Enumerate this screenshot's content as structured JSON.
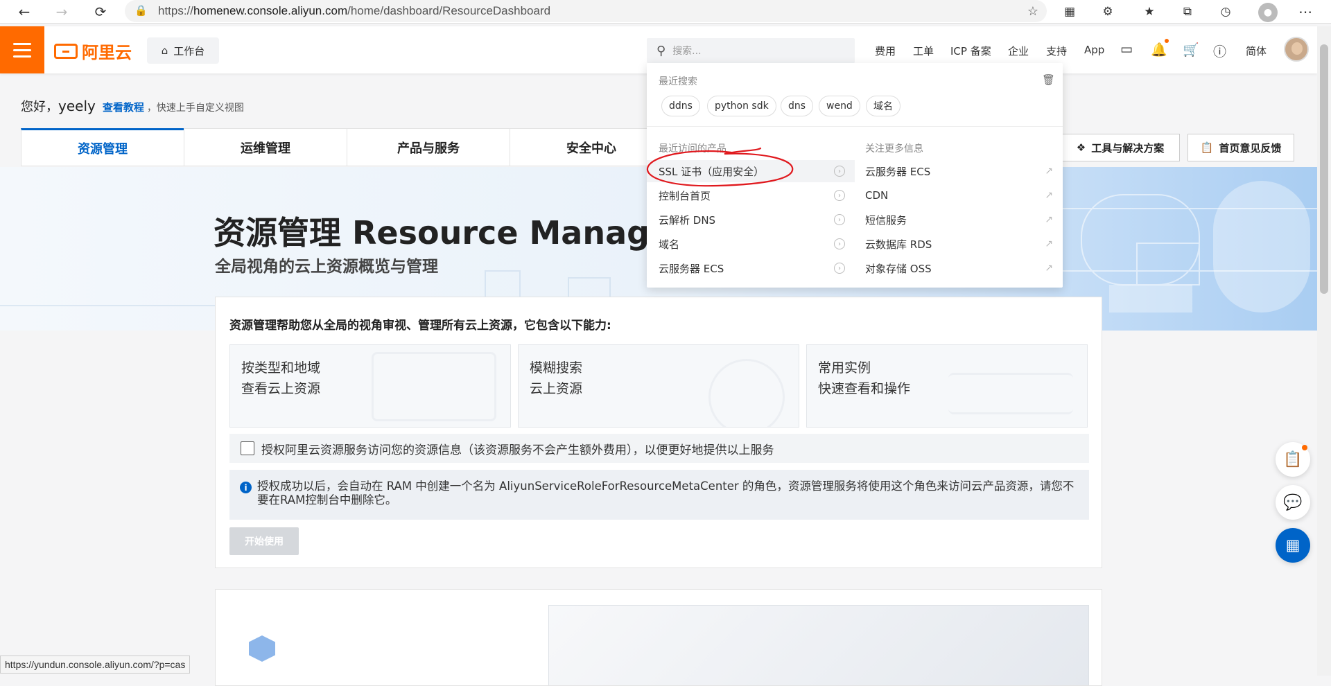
{
  "browser": {
    "url_prefix": "https://",
    "url_domain": "homenew.console.aliyun.com",
    "url_path": "/home/dashboard/ResourceDashboard",
    "status_url": "https://yundun.console.aliyun.com/?p=cas"
  },
  "header": {
    "brand": "阿里云",
    "workbench": "工作台",
    "search_placeholder": "搜索...",
    "nav": [
      "费用",
      "工单",
      "ICP 备案",
      "企业",
      "支持",
      "App"
    ],
    "lang": "简体",
    "accent_color": "#ff6a00"
  },
  "greeting": {
    "hello": "您好，",
    "name": "yeely",
    "tutorial_link": "查看教程",
    "hint": "，快速上手自定义视图"
  },
  "tabs": [
    "资源管理",
    "运维管理",
    "产品与服务",
    "安全中心"
  ],
  "toolbar": {
    "tools_label": "工具与解决方案",
    "feedback_label": "首页意见反馈"
  },
  "hero": {
    "title": "资源管理 Resource Manager",
    "subtitle": "全局视角的云上资源概览与管理"
  },
  "card": {
    "title": "资源管理帮助您从全局的视角审视、管理所有云上资源，它包含以下能力:",
    "features": [
      {
        "line1": "按类型和地域",
        "line2": "查看云上资源"
      },
      {
        "line1": "模糊搜索",
        "line2": "云上资源"
      },
      {
        "line1": "常用实例",
        "line2": "快速查看和操作"
      }
    ],
    "auth_text": "授权阿里云资源服务访问您的资源信息（该资源服务不会产生额外费用），以便更好地提供以上服务",
    "info_text": "授权成功以后，会自动在 RAM 中创建一个名为 AliyunServiceRoleForResourceMetaCenter 的角色，资源管理服务将使用这个角色来访问云产品资源，请您不要在RAM控制台中删除它。",
    "start_button": "开始使用"
  },
  "dropdown": {
    "recent_search_title": "最近搜索",
    "recent_searches": [
      "ddns",
      "python sdk",
      "dns",
      "wend",
      "域名"
    ],
    "recent_products_title": "最近访问的产品",
    "recent_products": [
      "SSL 证书（应用安全）",
      "控制台首页",
      "云解析 DNS",
      "域名",
      "云服务器 ECS"
    ],
    "more_info_title": "关注更多信息",
    "more_info": [
      "云服务器 ECS",
      "CDN",
      "短信服务",
      "云数据库 RDS",
      "对象存储 OSS"
    ],
    "annotation_color": "#e0191e"
  }
}
